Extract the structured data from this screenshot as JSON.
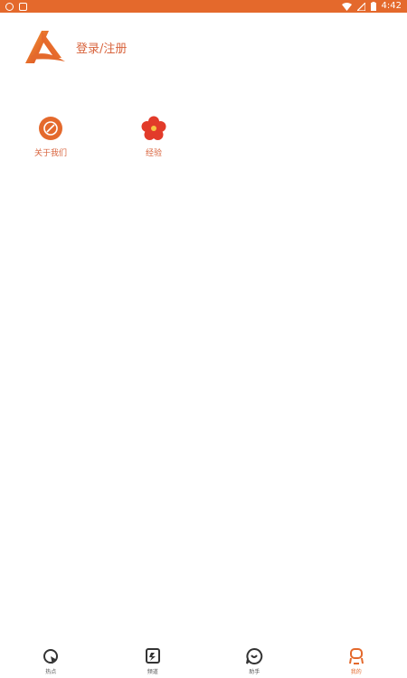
{
  "status_bar": {
    "time": "4:42",
    "left_icons": [
      "notification-icon",
      "notification-icon"
    ],
    "right_icons": [
      "wifi-icon",
      "signal-icon",
      "battery-icon"
    ]
  },
  "profile": {
    "login_label": "登录/注册"
  },
  "shortcuts": [
    {
      "label": "关于我们",
      "icon": "about-us-icon"
    },
    {
      "label": "经验",
      "icon": "flower-icon"
    }
  ],
  "bottom_nav": [
    {
      "label": "热点",
      "icon": "hotspot-icon",
      "active": false
    },
    {
      "label": "频道",
      "icon": "channel-icon",
      "active": false
    },
    {
      "label": "助手",
      "icon": "assistant-icon",
      "active": false
    },
    {
      "label": "我的",
      "icon": "profile-icon",
      "active": true
    }
  ],
  "colors": {
    "accent": "#e4692c",
    "text_accent": "#d8633c",
    "nav_inactive": "#555555",
    "background": "#ffffff"
  }
}
